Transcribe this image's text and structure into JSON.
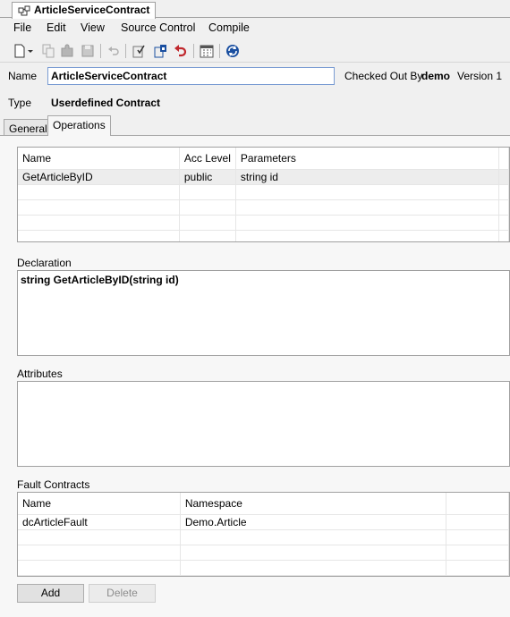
{
  "document_tab": {
    "title": "ArticleServiceContract",
    "icon": "contract-icon"
  },
  "menu": [
    "File",
    "Edit",
    "View",
    "Source Control",
    "Compile"
  ],
  "toolbar": {
    "buttons": [
      "new-icon",
      "copy-icon",
      "puzzle-icon",
      "save-icon",
      "undo-icon",
      "checkin-icon",
      "checkout-icon",
      "revert-icon",
      "calendar-icon",
      "sync-icon"
    ]
  },
  "header": {
    "name_label": "Name",
    "name_value": "ArticleServiceContract",
    "checked_out_label": "Checked Out By",
    "checked_out_user": "demo",
    "version": "Version 1",
    "type_label": "Type",
    "type_value": "Userdefined Contract"
  },
  "tabs": {
    "general": "General",
    "operations": "Operations"
  },
  "operations_grid": {
    "columns": [
      "Name",
      "Acc Level",
      "Parameters"
    ],
    "rows": [
      [
        "GetArticleByID",
        "public",
        "string id"
      ]
    ]
  },
  "declaration": {
    "label": "Declaration",
    "text": "string GetArticleByID(string id)"
  },
  "attributes": {
    "label": "Attributes"
  },
  "fault_contracts": {
    "label": "Fault Contracts",
    "columns": [
      "Name",
      "Namespace"
    ],
    "rows": [
      [
        "dcArticleFault",
        "Demo.Article"
      ]
    ]
  },
  "buttons": {
    "add": "Add",
    "delete": "Delete"
  },
  "colors": {
    "accent_blue": "#1a4fa0",
    "revert_red": "#c0282d",
    "input_border": "#7a9cd3"
  }
}
